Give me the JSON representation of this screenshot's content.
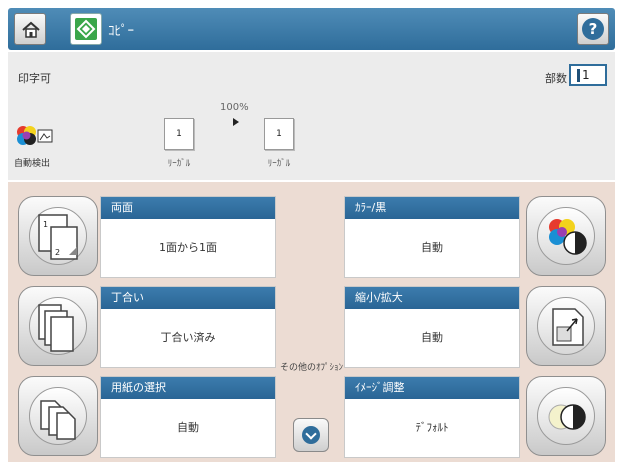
{
  "titlebar": {
    "title": "ｺﾋﾟｰ",
    "home_icon": "home-icon",
    "app_icon": "copy-start-icon",
    "help_icon": "help-icon",
    "help_glyph": "?"
  },
  "status": {
    "ready_text": "印字可",
    "copies_label": "部数",
    "copies_value": "1",
    "zoom": "100%",
    "original_page": "1",
    "original_label": "ﾘｰｶﾞﾙ",
    "output_page": "1",
    "output_label": "ﾘｰｶﾞﾙ",
    "color_mode_label": "自動検出"
  },
  "options": {
    "sides": {
      "title": "両面",
      "value": "1面から1面"
    },
    "collate": {
      "title": "丁合い",
      "value": "丁合い済み"
    },
    "paper": {
      "title": "用紙の選択",
      "value": "自動"
    },
    "color": {
      "title": "ｶﾗｰ/黒",
      "value": "自動"
    },
    "reduce_enlarge": {
      "title": "縮小/拡大",
      "value": "自動"
    },
    "image_adjust": {
      "title": "ｲﾒｰｼﾞ調整",
      "value": "ﾃﾞﾌｫﾙﾄ"
    },
    "more_options": "その他のｵﾌﾟｼｮﾝ"
  },
  "colors": {
    "accent": "#2f6d9b",
    "options_background": "#ecdcd3",
    "status_background": "#ececec"
  }
}
